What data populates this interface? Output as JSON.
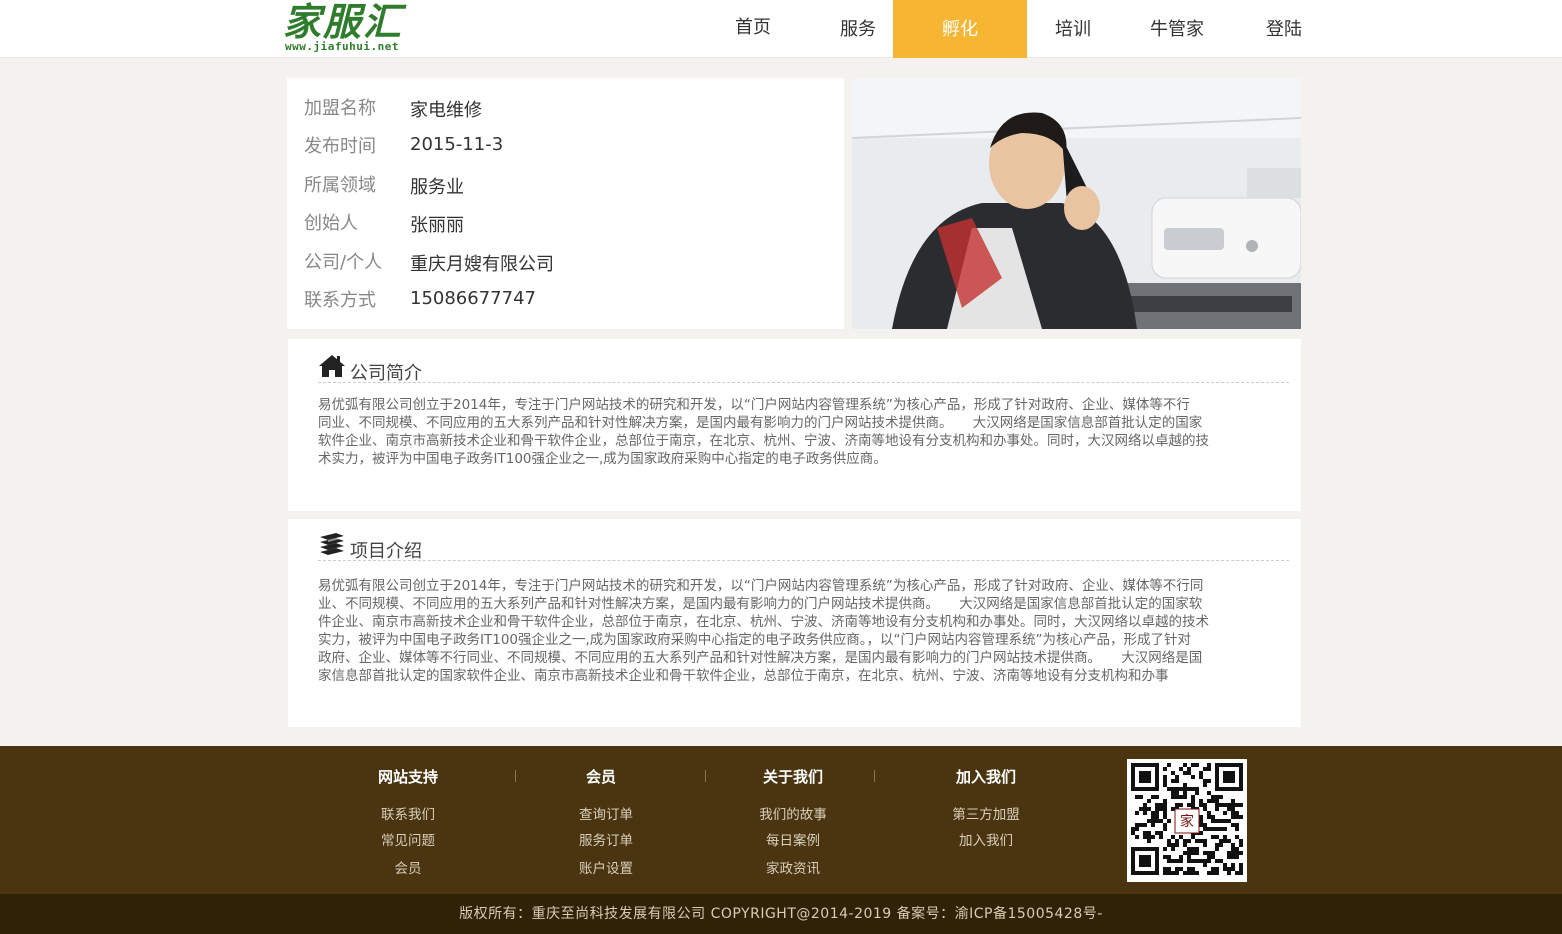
{
  "logo": {
    "name": "家服汇",
    "url": "www.jiafuhui.net"
  },
  "nav": {
    "items": [
      {
        "label": "首页"
      },
      {
        "label": "服务"
      },
      {
        "label": "孵化"
      },
      {
        "label": "培训"
      },
      {
        "label": "牛管家"
      },
      {
        "label": "登陆"
      }
    ],
    "active_index": 2
  },
  "info": {
    "rows": [
      {
        "label": "加盟名称",
        "value": "家电维修"
      },
      {
        "label": "发布时间",
        "value": "2015-11-3"
      },
      {
        "label": "所属领域",
        "value": "服务业"
      },
      {
        "label": "创始人",
        "value": "张丽丽"
      },
      {
        "label": "公司/个人",
        "value": "重庆月嫂有限公司"
      },
      {
        "label": "联系方式",
        "value": "15086677747"
      }
    ]
  },
  "company_intro": {
    "title": "公司简介",
    "lines": [
      "易优弧有限公司创立于2014年，专注于门户网站技术的研究和开发，以“门户网站内容管理系统”为核心产品，形成了针对政府、企业、媒体等不行",
      "同业、不同规模、不同应用的五大系列产品和针对性解决方案，是国内最有影响力的门户网站技术提供商。　　大汉网络是国家信息部首批认定的国家",
      "软件企业、南京市高新技术企业和骨干软件企业，总部位于南京，在北京、杭州、宁波、济南等地设有分支机构和办事处。同时，大汉网络以卓越的技",
      "术实力，被评为中国电子政务IT100强企业之一,成为国家政府采购中心指定的电子政务供应商。"
    ]
  },
  "project_intro": {
    "title": "项目介绍",
    "lines": [
      "易优弧有限公司创立于2014年，专注于门户网站技术的研究和开发，以“门户网站内容管理系统”为核心产品，形成了针对政府、企业、媒体等不行同",
      "业、不同规模、不同应用的五大系列产品和针对性解决方案，是国内最有影响力的门户网站技术提供商。　　大汉网络是国家信息部首批认定的国家软",
      "件企业、南京市高新技术企业和骨干软件企业，总部位于南京，在北京、杭州、宁波、济南等地设有分支机构和办事处。同时，大汉网络以卓越的技术",
      "实力，被评为中国电子政务IT100强企业之一,成为国家政府采购中心指定的电子政务供应商。，以“门户网站内容管理系统”为核心产品，形成了针对",
      "政府、企业、媒体等不行同业、不同规模、不同应用的五大系列产品和针对性解决方案，是国内最有影响力的门户网站技术提供商。　　大汉网络是国",
      "家信息部首批认定的国家软件企业、南京市高新技术企业和骨干软件企业，总部位于南京，在北京、杭州、宁波、济南等地设有分支机构和办事"
    ]
  },
  "footer": {
    "columns": [
      {
        "title": "网站支持",
        "links": [
          "联系我们",
          "常见问题",
          "会员"
        ]
      },
      {
        "title": "会员",
        "links": [
          "查询订单",
          "服务订单",
          "账户设置"
        ]
      },
      {
        "title": "关于我们",
        "links": [
          "我们的故事",
          "每日案例",
          "家政资讯"
        ]
      },
      {
        "title": "加入我们",
        "links": [
          "第三方加盟",
          "加入我们"
        ]
      }
    ],
    "qr_label": "家"
  },
  "copyright": "版权所有：重庆至尚科技发展有限公司 COPYRIGHT@2014-2019 备案号：渝ICP备15005428号-",
  "colors": {
    "accent": "#f7b534",
    "footer": "#4a3510",
    "brand_green": "#2f7d2c"
  }
}
